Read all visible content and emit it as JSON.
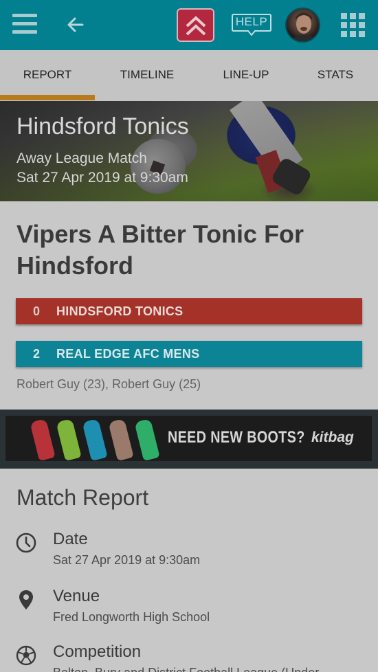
{
  "topbar": {
    "help_label": "HELP"
  },
  "tabs": [
    {
      "label": "REPORT",
      "active": true
    },
    {
      "label": "TIMELINE",
      "active": false
    },
    {
      "label": "LINE-UP",
      "active": false
    },
    {
      "label": "STATS",
      "active": false
    }
  ],
  "hero": {
    "team": "Hindsford Tonics",
    "match_type": "Away League Match",
    "datetime": "Sat 27 Apr 2019 at 9:30am"
  },
  "report": {
    "headline": "Vipers A Bitter Tonic For Hindsford",
    "home": {
      "score": "0",
      "name": "HINDSFORD TONICS"
    },
    "away": {
      "score": "2",
      "name": "REAL EDGE AFC MENS"
    },
    "scorers": "Robert Guy (23), Robert Guy (25)"
  },
  "banner": {
    "text": "NEED NEW BOOTS?",
    "brand": "kitbag"
  },
  "match_report": {
    "title": "Match Report",
    "date_label": "Date",
    "date_value": "Sat 27 Apr 2019 at 9:30am",
    "venue_label": "Venue",
    "venue_value": "Fred Longworth High School",
    "competition_label": "Competition",
    "competition_value": "Bolton, Bury and District Football League (Under"
  },
  "colors": {
    "topbar": "#028090",
    "home_team": "#a43228",
    "away_team": "#0d8496",
    "tab_underline": "#b87a1f"
  }
}
